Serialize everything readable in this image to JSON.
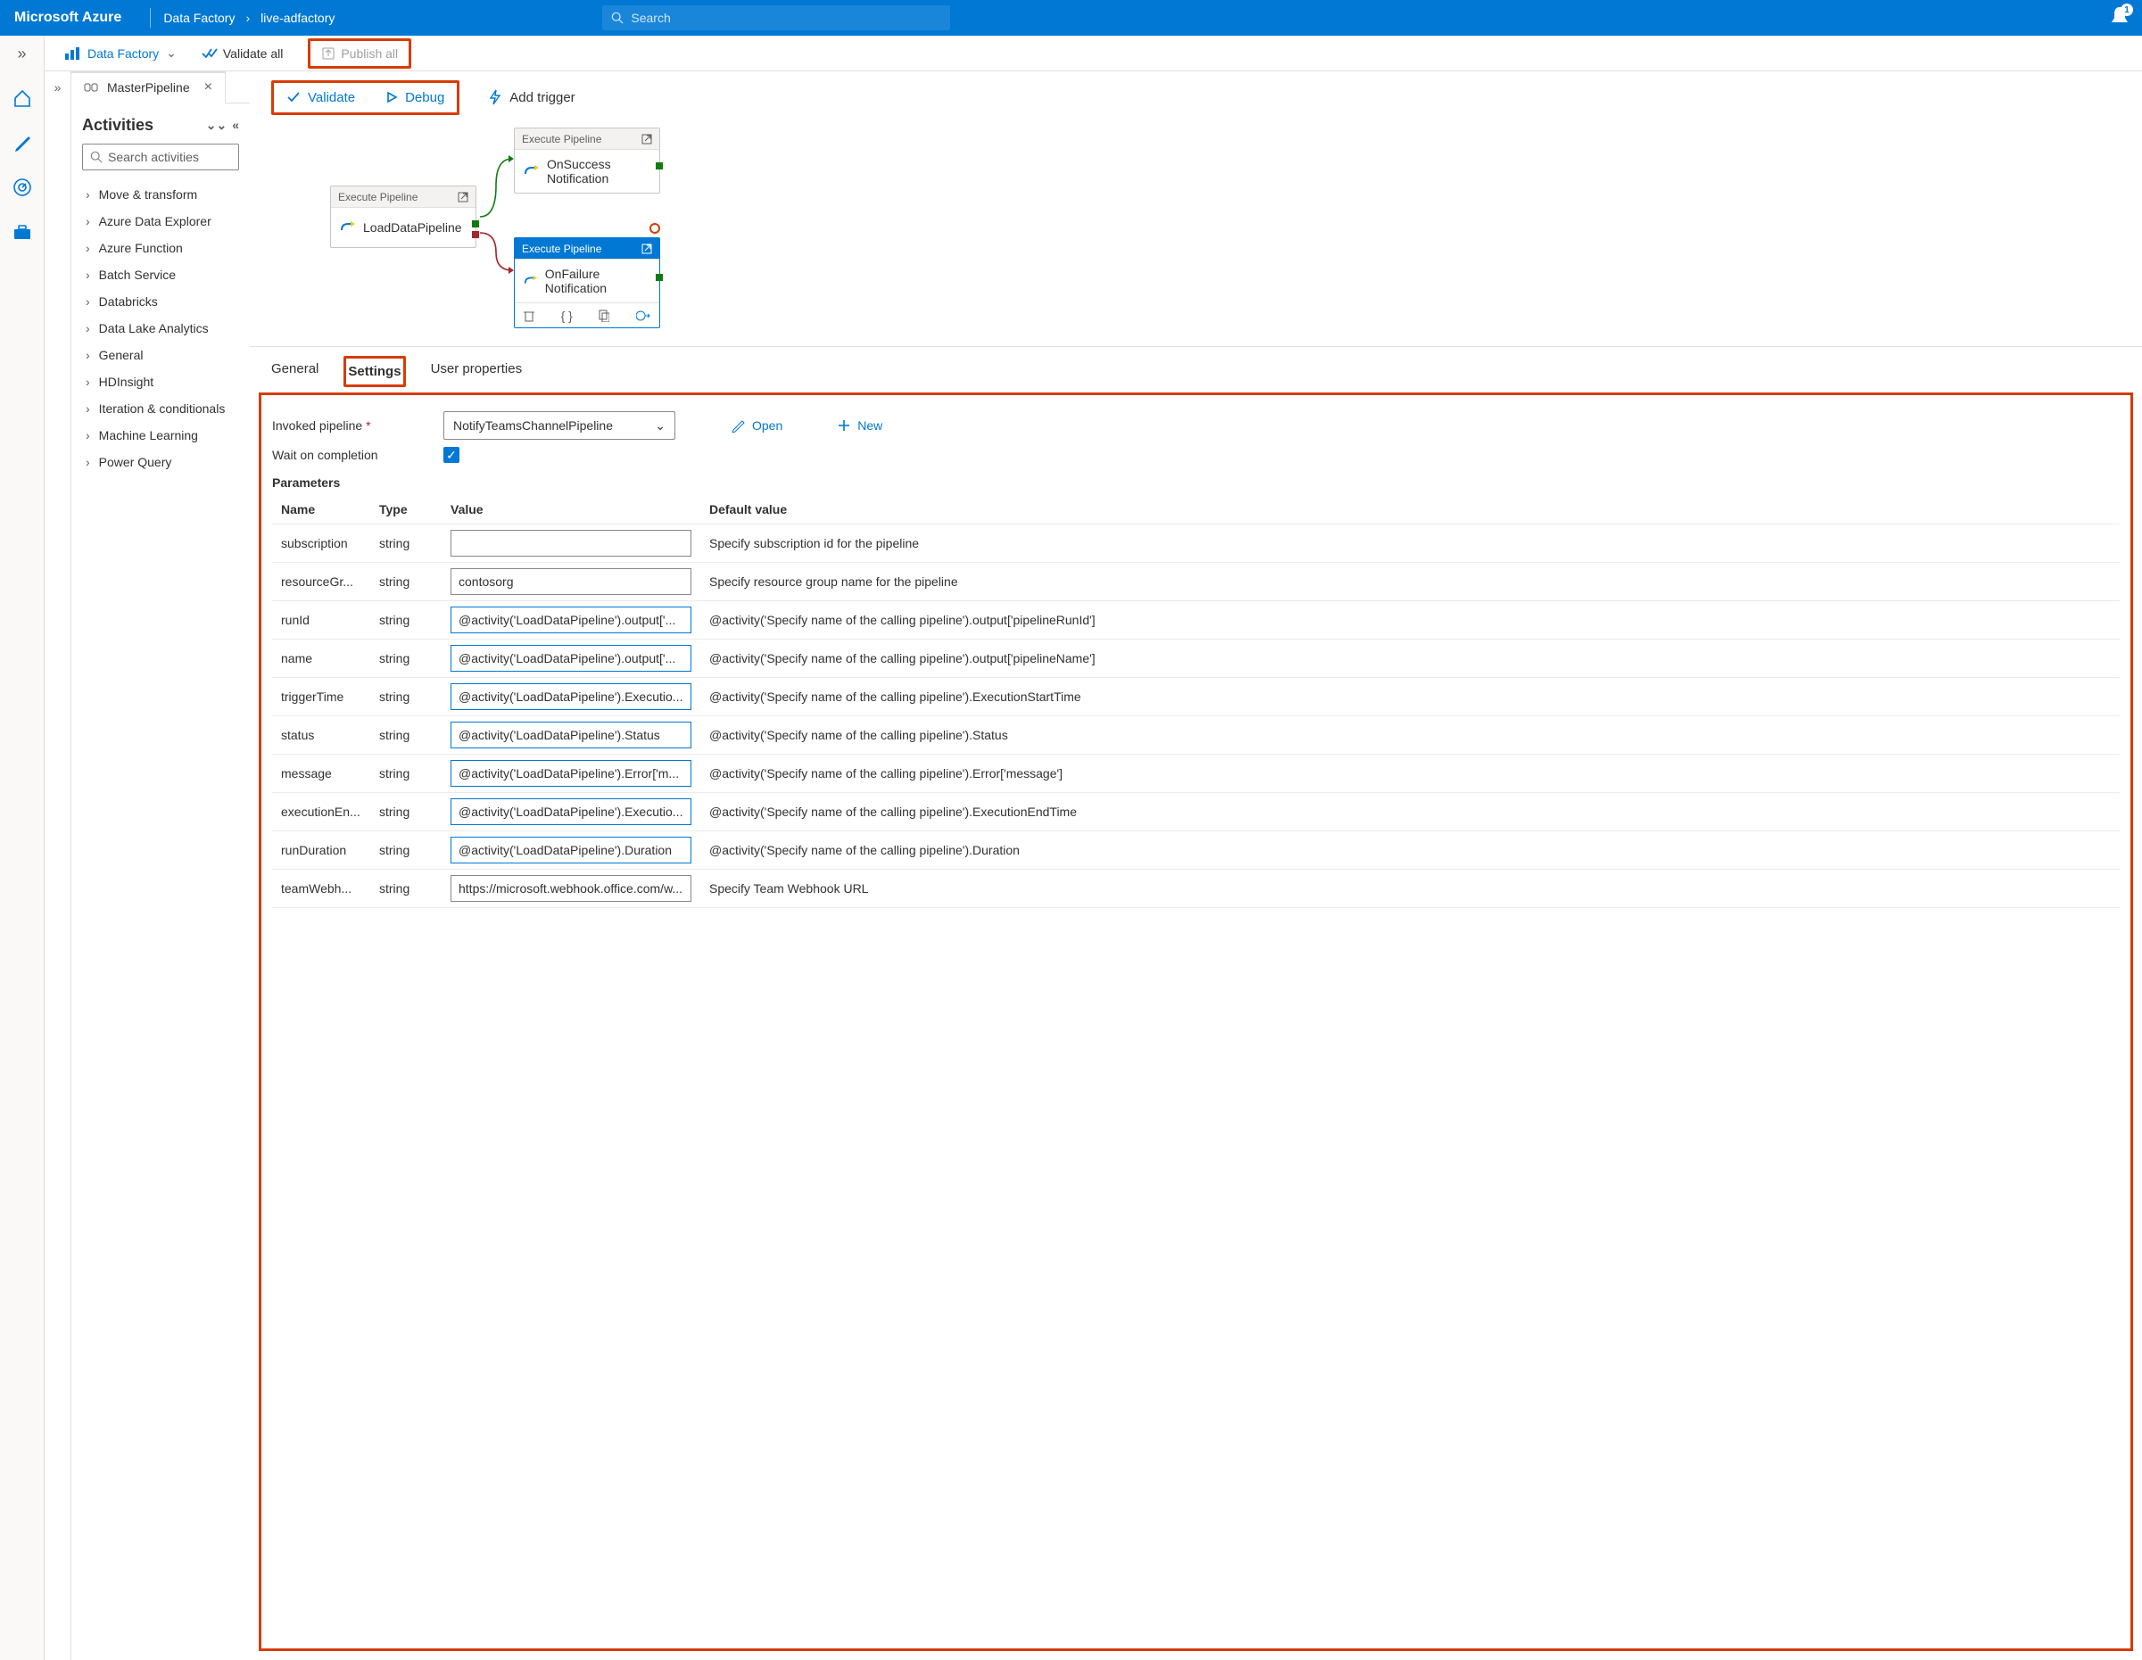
{
  "header": {
    "brand": "Microsoft Azure",
    "crumb1": "Data Factory",
    "crumb2": "live-adfactory",
    "search_placeholder": "Search",
    "bell_count": "1"
  },
  "toolbar": {
    "df_label": "Data Factory",
    "validate_all": "Validate all",
    "publish_all": "Publish all"
  },
  "tab": {
    "name": "MasterPipeline"
  },
  "activities": {
    "title": "Activities",
    "search_placeholder": "Search activities",
    "items": [
      "Move & transform",
      "Azure Data Explorer",
      "Azure Function",
      "Batch Service",
      "Databricks",
      "Data Lake Analytics",
      "General",
      "HDInsight",
      "Iteration & conditionals",
      "Machine Learning",
      "Power Query"
    ]
  },
  "canvas_toolbar": {
    "validate": "Validate",
    "debug": "Debug",
    "add_trigger": "Add trigger"
  },
  "diagram": {
    "exec_label": "Execute Pipeline",
    "node1": "LoadDataPipeline",
    "node2a": "OnSuccess",
    "node2b": "Notification",
    "node3": "OnFailure Notification"
  },
  "prop_tabs": {
    "general": "General",
    "settings": "Settings",
    "user": "User properties"
  },
  "settings": {
    "invoked_label": "Invoked pipeline",
    "invoked_value": "NotifyTeamsChannelPipeline",
    "open": "Open",
    "new": "New",
    "wait_label": "Wait on completion",
    "parameters_label": "Parameters",
    "headers": {
      "name": "Name",
      "type": "Type",
      "value": "Value",
      "default": "Default value"
    },
    "rows": [
      {
        "name": "subscription",
        "type": "string",
        "value": "",
        "expr": false,
        "default": "Specify subscription id for the pipeline"
      },
      {
        "name": "resourceGr...",
        "type": "string",
        "value": "contosorg",
        "expr": false,
        "default": "Specify resource group name for the pipeline"
      },
      {
        "name": "runId",
        "type": "string",
        "value": "@activity('LoadDataPipeline').output['...",
        "expr": true,
        "default": "@activity('Specify name of the calling pipeline').output['pipelineRunId']"
      },
      {
        "name": "name",
        "type": "string",
        "value": "@activity('LoadDataPipeline').output['...",
        "expr": true,
        "default": "@activity('Specify name of the calling pipeline').output['pipelineName']"
      },
      {
        "name": "triggerTime",
        "type": "string",
        "value": "@activity('LoadDataPipeline').Executio...",
        "expr": true,
        "default": "@activity('Specify name of the calling pipeline').ExecutionStartTime"
      },
      {
        "name": "status",
        "type": "string",
        "value": "@activity('LoadDataPipeline').Status",
        "expr": true,
        "default": "@activity('Specify name of the calling pipeline').Status"
      },
      {
        "name": "message",
        "type": "string",
        "value": "@activity('LoadDataPipeline').Error['m...",
        "expr": true,
        "default": "@activity('Specify name of the calling pipeline').Error['message']"
      },
      {
        "name": "executionEn...",
        "type": "string",
        "value": "@activity('LoadDataPipeline').Executio...",
        "expr": true,
        "default": "@activity('Specify name of the calling pipeline').ExecutionEndTime"
      },
      {
        "name": "runDuration",
        "type": "string",
        "value": "@activity('LoadDataPipeline').Duration",
        "expr": true,
        "default": "@activity('Specify name of the calling pipeline').Duration"
      },
      {
        "name": "teamWebh...",
        "type": "string",
        "value": "https://microsoft.webhook.office.com/w...",
        "expr": false,
        "default": "Specify Team Webhook URL"
      }
    ]
  }
}
